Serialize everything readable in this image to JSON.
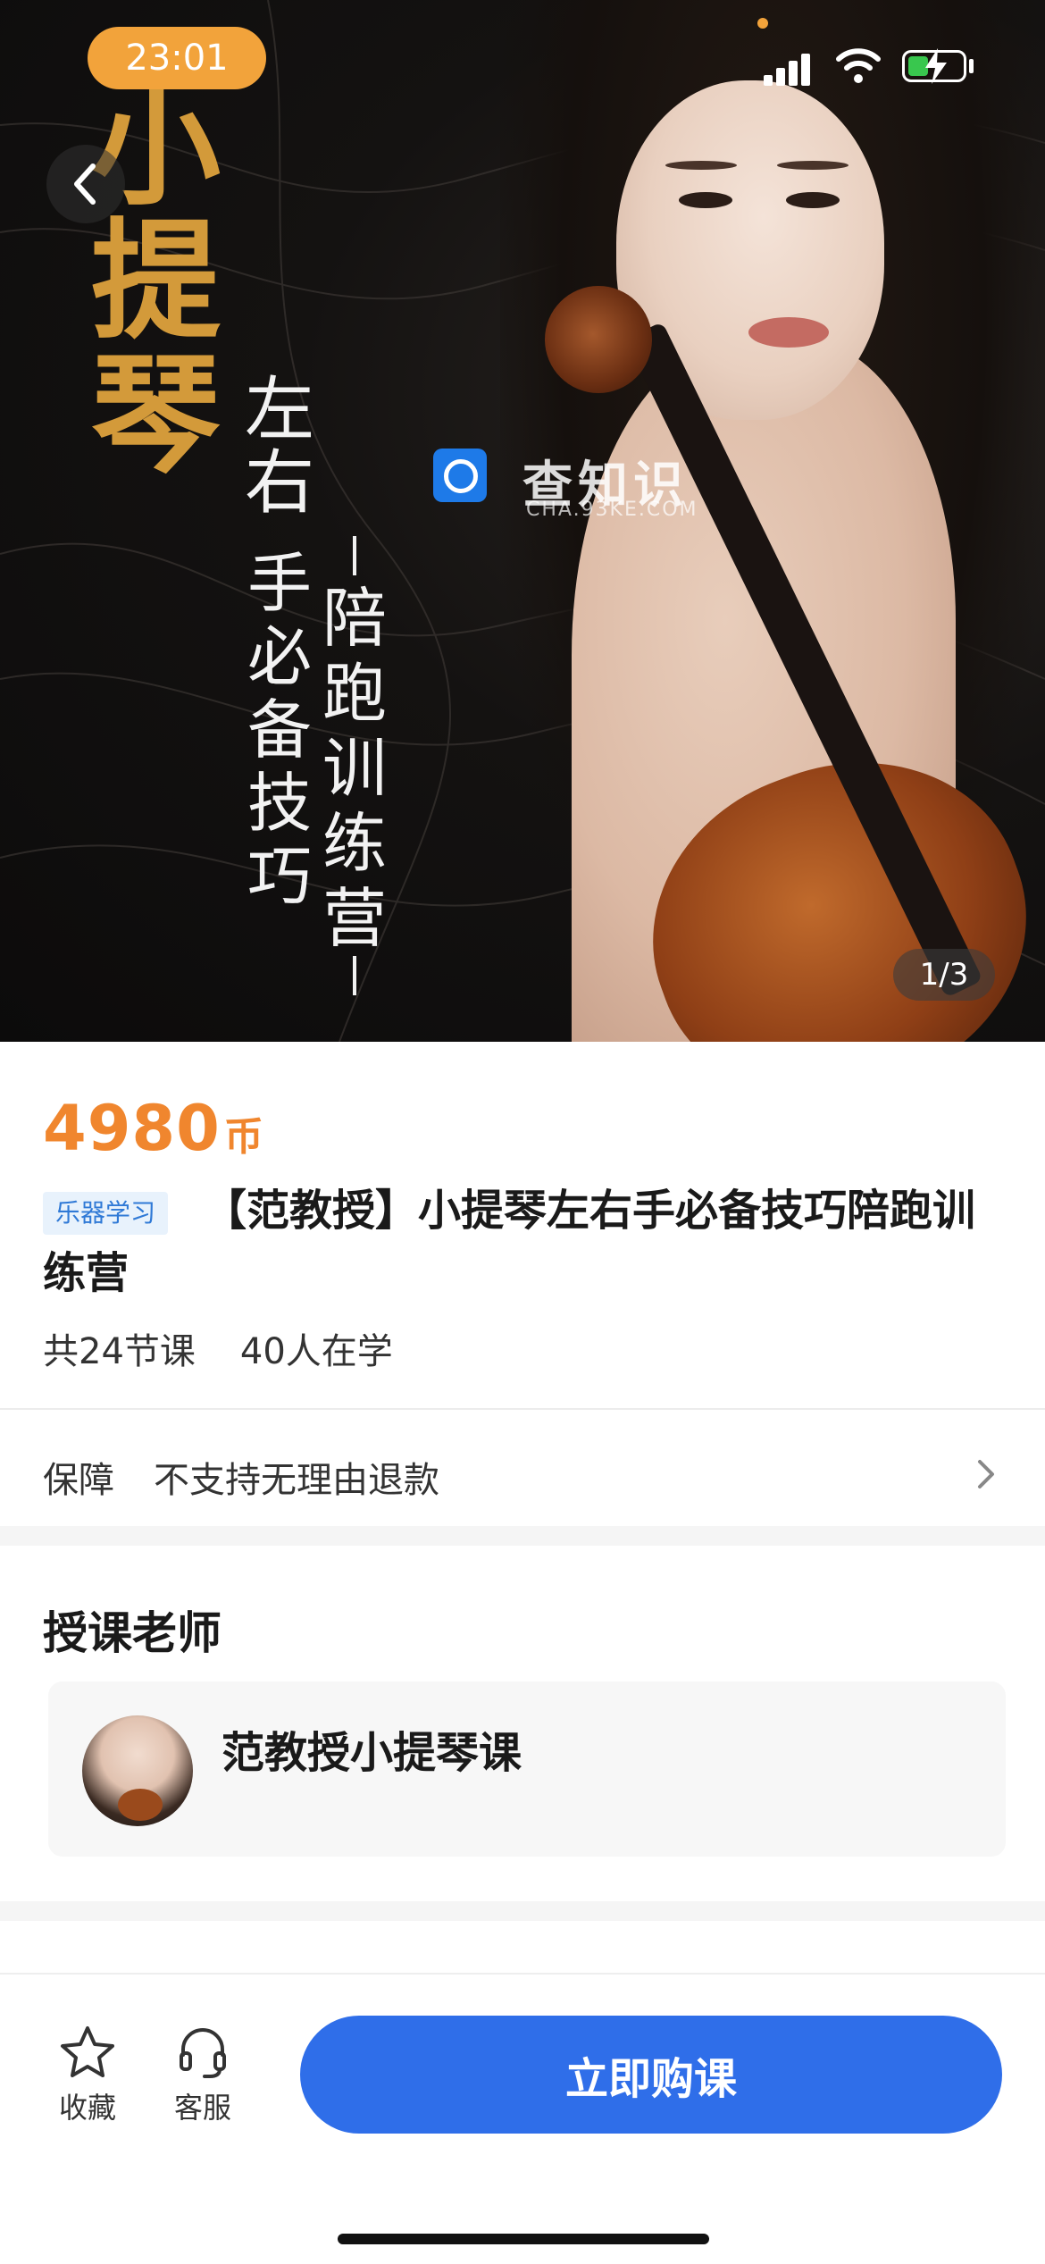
{
  "status_bar": {
    "time": "23:01"
  },
  "hero": {
    "title_chars": [
      "小",
      "提",
      "琴"
    ],
    "subtitle_left_top": [
      "左",
      "右"
    ],
    "subtitle_left": [
      "手",
      "必",
      "备",
      "技",
      "巧"
    ],
    "subtitle_right": [
      "陪",
      "跑",
      "训",
      "练",
      "营"
    ],
    "watermark_text": "查知识",
    "watermark_sub": "CHA.93KE.COM",
    "page_indicator": "1/3"
  },
  "course": {
    "price": "4980",
    "price_unit": "币",
    "tag": "乐器学习",
    "title": "【范教授】小提琴左右手必备技巧陪跑训练营",
    "lessons": "共24节课",
    "learners": "40人在学"
  },
  "guarantee": {
    "label": "保障",
    "value": "不支持无理由退款"
  },
  "teacher_section": {
    "title": "授课老师",
    "teacher_name": "范教授小提琴课"
  },
  "bottom_bar": {
    "favorite_label": "收藏",
    "service_label": "客服",
    "buy_label": "立即购课"
  },
  "colors": {
    "price": "#f0862e",
    "buy_button": "#2f6ee9",
    "tag_bg": "#e8f2fc",
    "tag_text": "#2f79d6",
    "hero_title": "#d39a3a",
    "time_pill": "#f2a33b"
  },
  "icons": {
    "back": "chevron-left-icon",
    "favorite": "star-icon",
    "service": "headset-icon",
    "guarantee_arrow": "chevron-right-icon"
  }
}
